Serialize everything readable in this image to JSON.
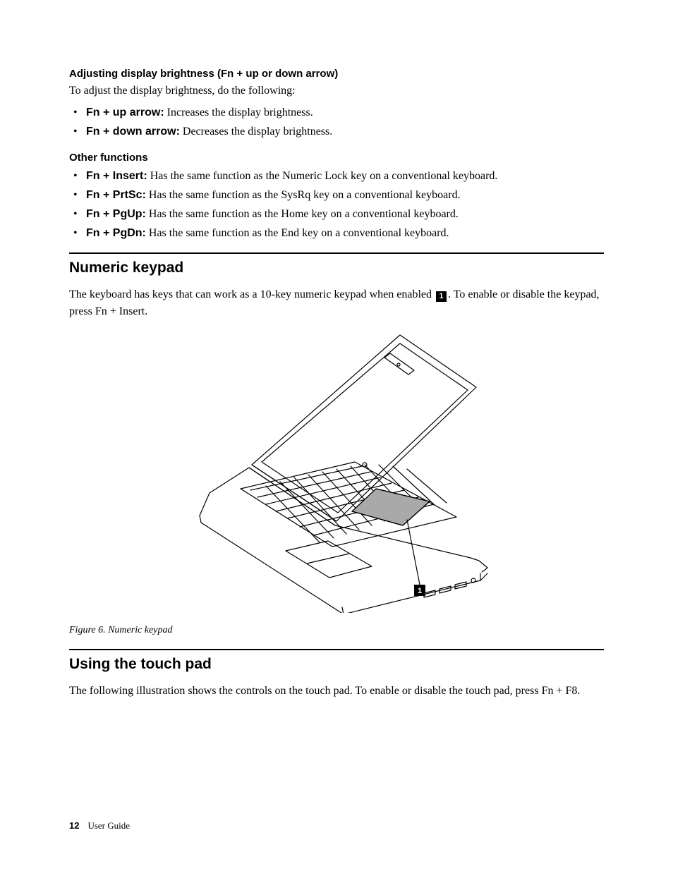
{
  "brightness": {
    "heading": "Adjusting display brightness (Fn + up or down arrow)",
    "intro": "To adjust the display brightness, do the following:",
    "items": [
      {
        "key": "Fn + up arrow:",
        "desc": " Increases the display brightness."
      },
      {
        "key": "Fn + down arrow:",
        "desc": " Decreases the display brightness."
      }
    ]
  },
  "other": {
    "heading": "Other functions",
    "items": [
      {
        "key": "Fn + Insert:",
        "desc": " Has the same function as the Numeric Lock key on a conventional keyboard."
      },
      {
        "key": "Fn + PrtSc:",
        "desc": " Has the same function as the SysRq key on a conventional keyboard."
      },
      {
        "key": "Fn + PgUp:",
        "desc": " Has the same function as the Home key on a conventional keyboard."
      },
      {
        "key": "Fn + PgDn:",
        "desc": " Has the same function as the End key on a conventional keyboard."
      }
    ]
  },
  "numeric": {
    "title": "Numeric keypad",
    "para_before": "The keyboard has keys that can work as a 10-key numeric keypad when enabled ",
    "callout": "1",
    "para_after": ". To enable or disable the keypad, press Fn + Insert.",
    "figure_caption": "Figure 6. Numeric keypad",
    "figure_callout": "1"
  },
  "touchpad": {
    "title": "Using the touch pad",
    "para": "The following illustration shows the controls on the touch pad. To enable or disable the touch pad, press Fn + F8."
  },
  "footer": {
    "page": "12",
    "label": "User Guide"
  }
}
